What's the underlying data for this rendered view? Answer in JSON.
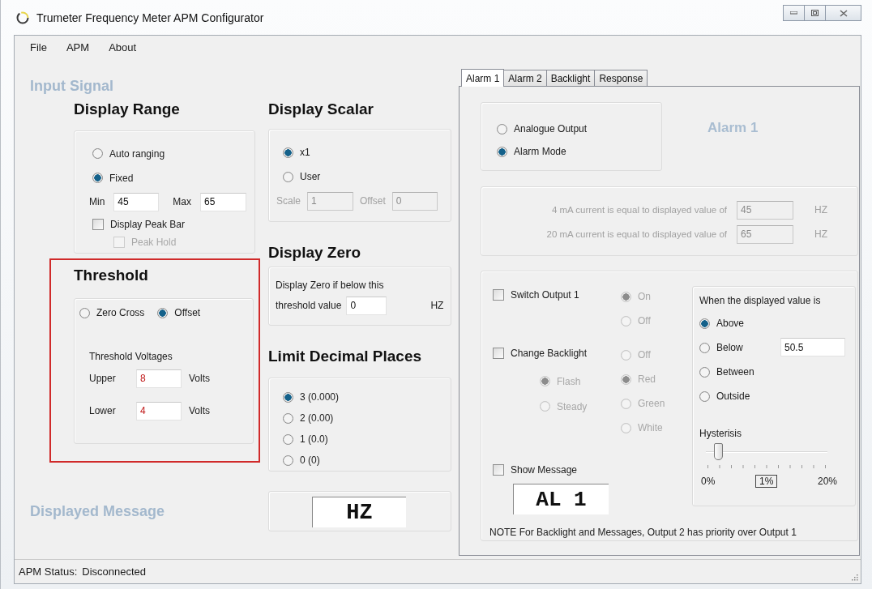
{
  "window": {
    "title": "Trumeter Frequency Meter APM Configurator"
  },
  "menu": [
    "File",
    "APM",
    "About"
  ],
  "input_signal": {
    "heading": "Input Signal"
  },
  "display_range": {
    "heading": "Display Range",
    "options": [
      {
        "label": "Auto ranging",
        "selected": false
      },
      {
        "label": "Fixed",
        "selected": true
      }
    ],
    "min": {
      "label": "Min",
      "value": "45"
    },
    "max": {
      "label": "Max",
      "value": "65"
    },
    "peak_bar": {
      "label": "Display Peak Bar",
      "checked": false
    },
    "peak_hold": {
      "label": "Peak Hold",
      "checked": false,
      "disabled": true
    }
  },
  "threshold": {
    "heading": "Threshold",
    "highlighted": true,
    "options": [
      {
        "label": "Zero Cross",
        "selected": false
      },
      {
        "label": "Offset",
        "selected": true
      }
    ],
    "voltages_label": "Threshold Voltages",
    "rows": [
      {
        "label": "Upper",
        "value": "8",
        "unit": "Volts"
      },
      {
        "label": "Lower",
        "value": "4",
        "unit": "Volts"
      }
    ]
  },
  "displayed_message": {
    "heading": "Displayed Message"
  },
  "display_scalar": {
    "heading": "Display Scalar",
    "options": [
      {
        "label": "x1",
        "selected": true
      },
      {
        "label": "User",
        "selected": false
      }
    ],
    "fields_disabled": true,
    "scale": {
      "label": "Scale",
      "value": "1"
    },
    "offset": {
      "label": "Offset",
      "value": "0"
    }
  },
  "display_zero": {
    "heading": "Display Zero",
    "text": "Display Zero if below this",
    "label": "threshold value",
    "value": "0",
    "unit": "HZ"
  },
  "decimal_places": {
    "heading": "Limit Decimal Places",
    "options": [
      {
        "label": "3 (0.000)",
        "selected": true
      },
      {
        "label": "2 (0.00)",
        "selected": false
      },
      {
        "label": "1 (0.0)",
        "selected": false
      },
      {
        "label": "0 (0)",
        "selected": false
      }
    ]
  },
  "message_display": "HZ",
  "tabs": [
    {
      "label": "Alarm 1",
      "selected": true
    },
    {
      "label": "Alarm 2",
      "selected": false
    },
    {
      "label": "Backlight",
      "selected": false
    },
    {
      "label": "Response",
      "selected": false
    }
  ],
  "alarm": {
    "title": "Alarm 1",
    "modes": [
      {
        "label": "Analogue Output",
        "selected": false
      },
      {
        "label": "Alarm Mode",
        "selected": true
      }
    ],
    "analogue": {
      "disabled": true,
      "rows": [
        {
          "label": "4 mA current is equal to displayed value of",
          "value": "45",
          "unit": "HZ"
        },
        {
          "label": "20 mA current is equal to displayed value of",
          "value": "65",
          "unit": "HZ"
        }
      ]
    },
    "switch_output": {
      "label": "Switch Output 1",
      "checked": false,
      "options_disabled": true,
      "options": [
        {
          "label": "On",
          "selected": true
        },
        {
          "label": "Off",
          "selected": false
        }
      ]
    },
    "backlight": {
      "label": "Change Backlight",
      "checked": false,
      "options_disabled": true,
      "modes": [
        {
          "label": "Flash",
          "selected": true
        },
        {
          "label": "Steady",
          "selected": false
        }
      ],
      "colors": [
        {
          "label": "Off",
          "selected": false
        },
        {
          "label": "Red",
          "selected": true
        },
        {
          "label": "Green",
          "selected": false
        },
        {
          "label": "White",
          "selected": false
        }
      ]
    },
    "show_message": {
      "label": "Show Message",
      "checked": false,
      "display": "AL 1"
    },
    "condition": {
      "heading": "When the displayed value is",
      "options": [
        {
          "label": "Above",
          "selected": true
        },
        {
          "label": "Below",
          "selected": false
        },
        {
          "label": "Between",
          "selected": false
        },
        {
          "label": "Outside",
          "selected": false
        }
      ],
      "value": "50.5",
      "hysteresis": {
        "label": "Hysterisis",
        "level": 0.05,
        "min": "0%",
        "value": "1%",
        "max": "20%"
      }
    },
    "note": "NOTE  For Backlight and Messages, Output 2 has priority over Output 1"
  },
  "status_bar": {
    "label": "APM Status:",
    "value": "Disconnected"
  }
}
